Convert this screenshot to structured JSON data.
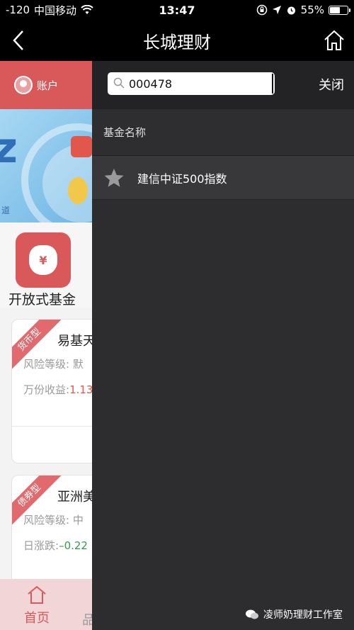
{
  "status": {
    "signal": "-120",
    "carrier": "中国移动",
    "time": "13:47",
    "battery": "55%",
    "battery_level": 0.55
  },
  "nav": {
    "title": "长城理财"
  },
  "background": {
    "account_label": "账户",
    "banner_char": "z",
    "banner_text": "道",
    "fund_entry_label": "开放式基金",
    "cards": [
      {
        "tag": "货币型",
        "name": "易基天",
        "risk": "风险等级: 默",
        "income_label": "万份收益:",
        "income_value": "1.13"
      },
      {
        "tag": "债券型",
        "name": "亚洲美",
        "risk": "风险等级: 中",
        "income_label": "日涨跌:",
        "income_value": "–0.22"
      }
    ],
    "tabs": {
      "home": "首页",
      "second": "品"
    }
  },
  "panel": {
    "search_value": "000478",
    "close_label": "关闭",
    "section_header": "基金名称",
    "results": [
      {
        "name": "建信中证500指数"
      }
    ]
  },
  "watermark": {
    "text": "凌师奶理财工作室"
  },
  "colors": {
    "brand_red": "#d9585a",
    "panel_bg": "#2d2d30",
    "positive": "#e2574c",
    "negative": "#2e9b4a"
  }
}
